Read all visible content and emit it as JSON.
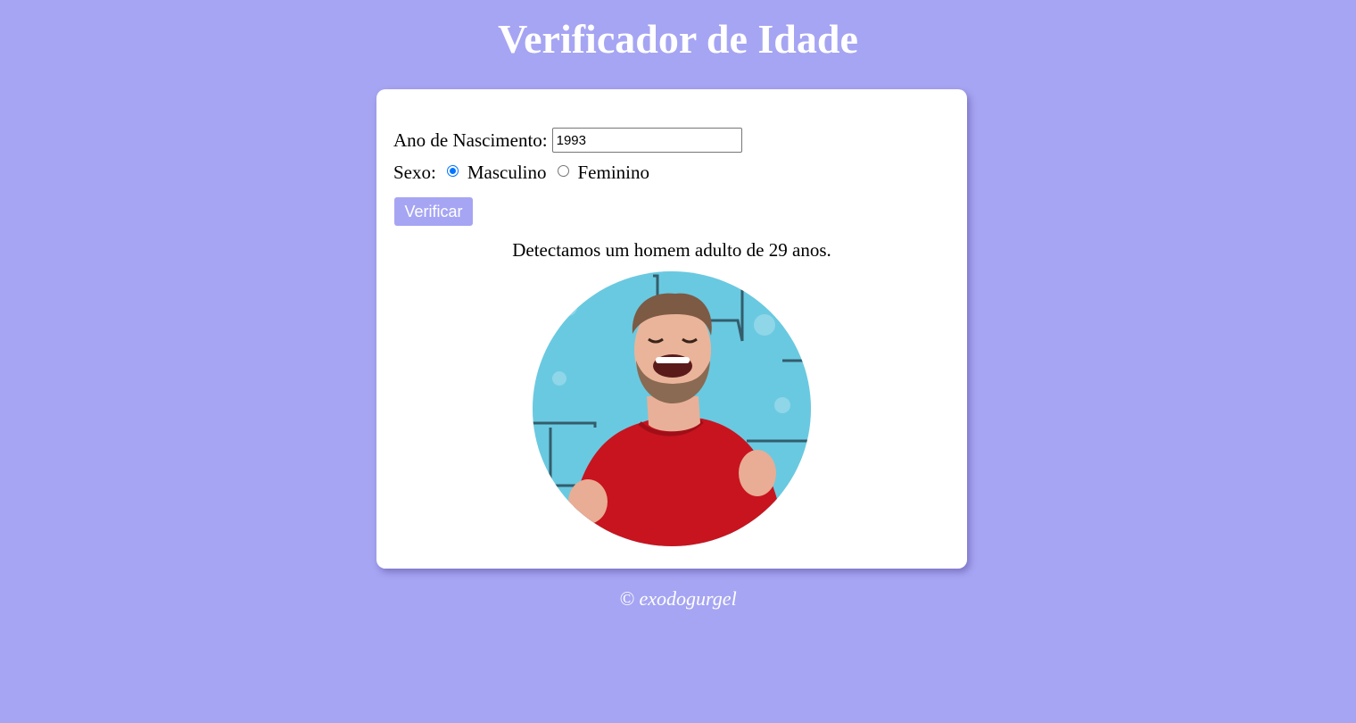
{
  "page": {
    "title": "Verificador de Idade",
    "background_color": "#a6a5f3",
    "card_color": "#ffffff"
  },
  "form": {
    "year_label": "Ano de Nascimento:",
    "year_value": "1993",
    "sex_label": "Sexo:",
    "sex_options": [
      {
        "label": "Masculino",
        "checked": true
      },
      {
        "label": "Feminino",
        "checked": false
      }
    ],
    "submit_label": "Verificar",
    "button_color": "#a6a5f3"
  },
  "result": {
    "text": "Detectamos um homem adulto de 29 anos.",
    "image": "laughing-man-red-sweater-photo"
  },
  "footer": {
    "text": "© exodogurgel"
  }
}
